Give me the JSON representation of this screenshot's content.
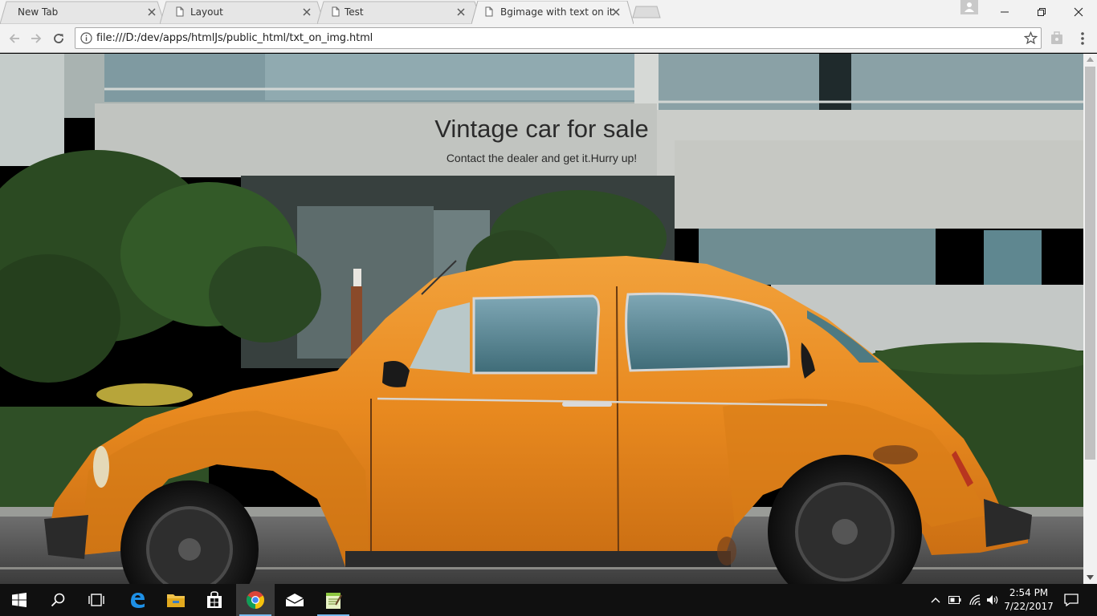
{
  "browser": {
    "tabs": [
      {
        "label": "New Tab",
        "active": false
      },
      {
        "label": "Layout",
        "active": false
      },
      {
        "label": "Test",
        "active": false
      },
      {
        "label": "Bgimage with text on it",
        "active": true
      }
    ],
    "url": "file:///D:/dev/apps/htmlJs/public_html/txt_on_img.html"
  },
  "page": {
    "title": "Vintage car for sale",
    "subtitle": "Contact the dealer and get it.Hurry up!"
  },
  "taskbar": {
    "clock_time": "2:54 PM",
    "clock_date": "7/22/2017",
    "pinned": [
      "windows-start",
      "search",
      "task-view",
      "edge",
      "file-explorer",
      "store",
      "chrome",
      "mail",
      "notepad-plus"
    ]
  },
  "colors": {
    "car_orange": "#e8891f",
    "chrome_bg": "#f2f2f2",
    "taskbar_bg": "#101010",
    "taskbar_accent": "#76b9ed"
  }
}
